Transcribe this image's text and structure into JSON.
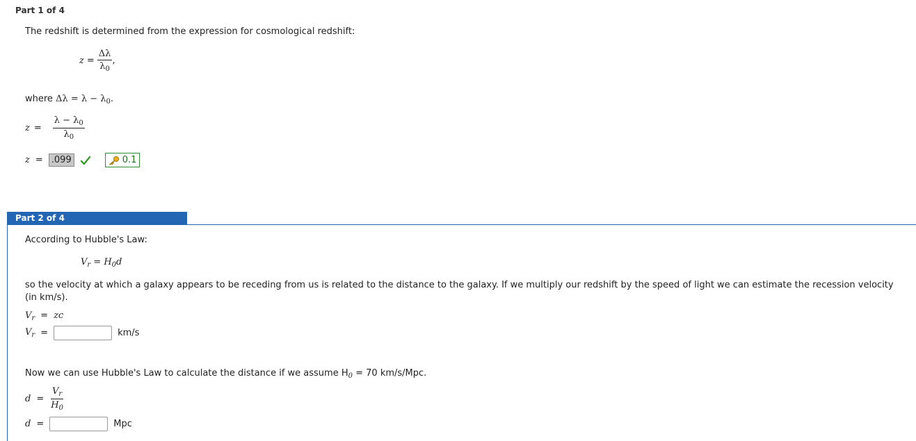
{
  "part1": {
    "header": "Part 1 of 4",
    "intro": "The redshift is determined from the expression for cosmological redshift:",
    "z_sym": "z",
    "eq": "=",
    "delta_lambda": "Δλ",
    "lambda0": "λ",
    "sub0": "0",
    "comma": ",",
    "where_text": "where",
    "where_eq": "Δλ = λ − λ",
    "period": ".",
    "frac2_num": "λ − λ",
    "answer_value": ".099",
    "key_value": "0.1"
  },
  "part2": {
    "header": "Part 2 of 4",
    "intro": "According to Hubble's Law:",
    "law_v": "V",
    "law_r": "r",
    "law_eq": " = H",
    "law_d": "d",
    "velocity_text": "so the velocity at which a galaxy appears to be receding from us is related to the distance to the galaxy. If we multiply our redshift by the speed of light we can estimate the recession velocity",
    "velocity_text2": "(in km/s).",
    "zc": "zc",
    "vel_unit": "km/s",
    "distance_text_a": "Now we can use Hubble's Law to calculate the distance if we assume H",
    "distance_text_b": " = 70 km/s/Mpc.",
    "d_sym": "d",
    "h_sym": "H",
    "dist_unit": "Mpc",
    "velocity_input_value": "",
    "distance_input_value": ""
  },
  "colors": {
    "accent": "#2366b3",
    "correct": "#3a9a2e"
  }
}
